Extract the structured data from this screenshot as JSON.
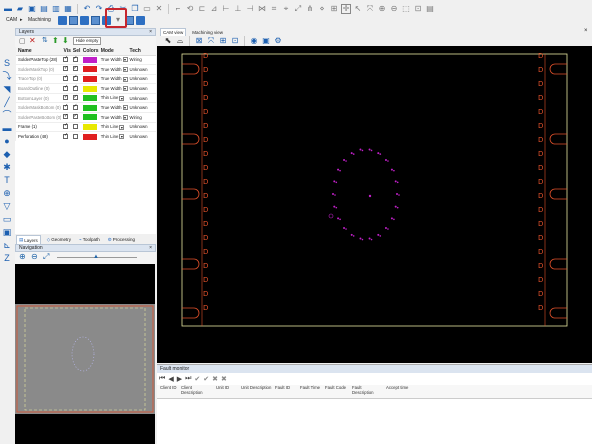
{
  "app": {
    "breadcrumb": {
      "root": "CAM",
      "arrow": "▸",
      "current": "Machining"
    }
  },
  "layers_panel": {
    "title": "Layers",
    "hide_empty_label": "Hide empty",
    "columns": [
      "Name",
      "Vis",
      "Sel",
      "Colors",
      "Mode",
      "Tech"
    ],
    "rows": [
      {
        "name": "SolderPasteTop (28)",
        "vis": true,
        "sel": true,
        "color": "#c020c8",
        "mode": "True Width",
        "tech": "Wiring",
        "active": true
      },
      {
        "name": "SolderMaskTop (0)",
        "vis": true,
        "sel": true,
        "color": "#e02020",
        "mode": "True Width",
        "tech": "Unknown",
        "active": false
      },
      {
        "name": "TraceTop (0)",
        "vis": true,
        "sel": true,
        "color": "#e02020",
        "mode": "True Width",
        "tech": "Unknown",
        "active": false
      },
      {
        "name": "BoardOutline (0)",
        "vis": true,
        "sel": true,
        "color": "#e8e800",
        "mode": "True Width",
        "tech": "Unknown",
        "active": false
      },
      {
        "name": "BottomLayer (0)",
        "vis": true,
        "sel": true,
        "color": "#20c020",
        "mode": "Thin Line",
        "tech": "Unknown",
        "active": false
      },
      {
        "name": "SolderMaskBottom (0)",
        "vis": true,
        "sel": true,
        "color": "#20c020",
        "mode": "True Width",
        "tech": "Unknown",
        "active": false
      },
      {
        "name": "SolderPasteBottom (0)",
        "vis": true,
        "sel": true,
        "color": "#20c020",
        "mode": "True Width",
        "tech": "Wiring",
        "active": false
      },
      {
        "name": "Frame (1)",
        "vis": true,
        "sel": false,
        "color": "#e8e800",
        "mode": "Thin Line",
        "tech": "Unknown",
        "active": true
      },
      {
        "name": "Perforation (48)",
        "vis": true,
        "sel": false,
        "color": "#e02020",
        "mode": "Thin Line",
        "tech": "Unknown",
        "active": true
      }
    ],
    "tabs": [
      "Layers",
      "Geometry",
      "Toolpath",
      "Processing"
    ]
  },
  "navigation_panel": {
    "title": "Navigation"
  },
  "views": {
    "tabs": [
      "CAM view",
      "Machining view"
    ]
  },
  "fault_monitor": {
    "title": "Fault monitor",
    "columns": [
      "Client ID",
      "Client Description",
      "Unit ID",
      "Unit Description",
      "Fault ID",
      "Fault Time",
      "Fault Code",
      "Fault Description",
      "Accept time"
    ]
  },
  "colors": {
    "highlight": "#c6262e",
    "board_outline": "#e8e8a0",
    "slot": "#e0502a",
    "paste": "#c020c8"
  },
  "icons": [
    "save-icon",
    "open-icon",
    "print-icon",
    "undo-icon",
    "redo-icon",
    "cut-icon",
    "copy-icon",
    "paste-icon",
    "delete-icon",
    "zoom-icon",
    "snap-icon",
    "measure-icon",
    "machine-icon"
  ]
}
